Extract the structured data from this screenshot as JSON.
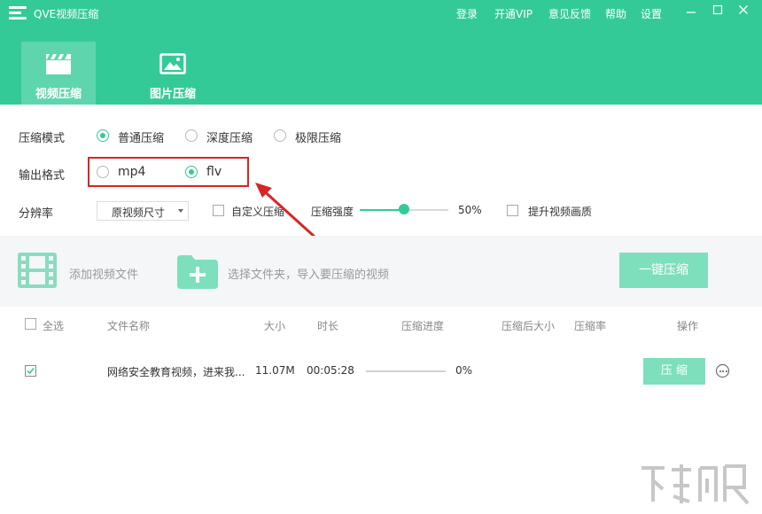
{
  "window": {
    "title": "QVE视频压缩",
    "links": [
      "登录",
      "开通VIP",
      "意见反馈",
      "帮助",
      "设置"
    ],
    "controls": [
      "minimize-icon",
      "maximize-icon",
      "close-icon"
    ]
  },
  "tabs": [
    {
      "label": "视频压缩",
      "icon": "video-clapper-icon",
      "active": true
    },
    {
      "label": "图片压缩",
      "icon": "image-icon",
      "active": false
    }
  ],
  "settings": {
    "mode": {
      "label": "压缩模式",
      "options": [
        "普通压缩",
        "深度压缩",
        "极限压缩"
      ],
      "selected": "普通压缩"
    },
    "format": {
      "label": "输出格式",
      "options": [
        "mp4",
        "flv"
      ],
      "selected": "flv"
    },
    "resolution": {
      "label": "分辨率",
      "value": "原视频尺寸"
    },
    "custom_compress": {
      "label": "自定义压缩",
      "checked": false
    },
    "strength": {
      "label": "压缩强度",
      "value": "50%",
      "level": 0.5
    },
    "enhance": {
      "label": "提升视频画质",
      "checked": false
    }
  },
  "toolbar": {
    "add_video": "添加视频文件",
    "add_folder": "选择文件夹，导入要压缩的视频",
    "compress_all": "一键压缩"
  },
  "table": {
    "headers": {
      "select_all": "全选",
      "name": "文件名称",
      "size": "大小",
      "duration": "时长",
      "progress": "压缩进度",
      "size_after": "压缩后大小",
      "ratio": "压缩率",
      "action": "操作"
    },
    "rows": [
      {
        "checked": true,
        "name": "网络安全教育视频，进来我...",
        "size": "11.07M",
        "duration": "00:05:28",
        "progress": "0%",
        "progress_level": 0,
        "action": "压 缩"
      }
    ]
  },
  "colors": {
    "brand": "#34ca98",
    "button": "#7edfbd",
    "annotation": "#d92424"
  }
}
